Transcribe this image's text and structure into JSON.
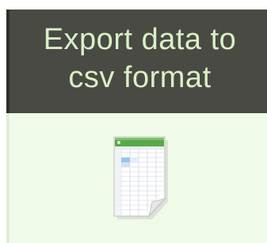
{
  "header": {
    "title_line1": "Export data to",
    "title_line2": "csv format"
  },
  "export": {
    "icon": "spreadsheet-file-icon"
  },
  "colors": {
    "header_bg": "#4a4a44",
    "header_text": "#d9f0c6",
    "panel_bg": "#f0fae8",
    "sheet_green": "#5aa84a"
  }
}
